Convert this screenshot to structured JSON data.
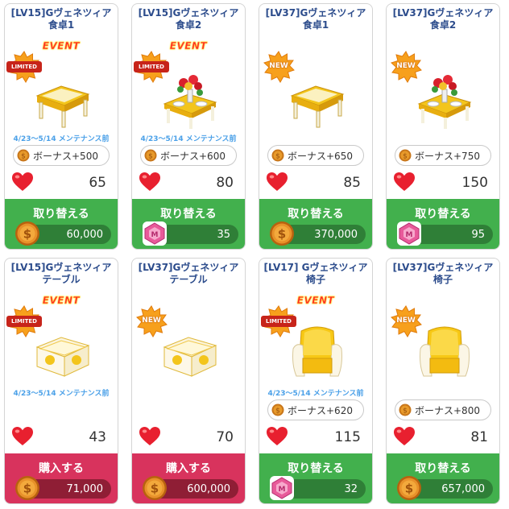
{
  "event_text": "EVENT",
  "cards": [
    {
      "title": "[LV15]Gヴェネツィア",
      "subtitle": "食卓1",
      "badge": "LIMITED",
      "event": true,
      "item": "table-glass",
      "period": "4/23～5/14 メンテナンス前",
      "bonus": "ボーナス+500",
      "likes": "65",
      "action": "取り替える",
      "action_color": "green",
      "currency": "coin",
      "price": "60,000"
    },
    {
      "title": "[LV15]Gヴェネツィア",
      "subtitle": "食卓2",
      "badge": "LIMITED",
      "event": true,
      "item": "table-flowers",
      "period": "4/23～5/14 メンテナンス前",
      "bonus": "ボーナス+600",
      "likes": "80",
      "action": "取り替える",
      "action_color": "green",
      "currency": "gem",
      "price": "35"
    },
    {
      "title": "[LV37]Gヴェネツィア",
      "subtitle": "食卓1",
      "badge": "NEW",
      "event": false,
      "item": "table-glass",
      "period": "",
      "bonus": "ボーナス+650",
      "likes": "85",
      "action": "取り替える",
      "action_color": "green",
      "currency": "coin",
      "price": "370,000"
    },
    {
      "title": "[LV37]Gヴェネツィア",
      "subtitle": "食卓2",
      "badge": "NEW",
      "event": false,
      "item": "table-flowers",
      "period": "",
      "bonus": "ボーナス+750",
      "likes": "150",
      "action": "取り替える",
      "action_color": "green",
      "currency": "gem",
      "price": "95"
    },
    {
      "title": "[LV15]Gヴェネツィア",
      "subtitle": "テーブル",
      "badge": "LIMITED",
      "event": true,
      "item": "low-table",
      "period": "4/23～5/14 メンテナンス前",
      "bonus": "",
      "likes": "43",
      "action": "購入する",
      "action_color": "pink",
      "currency": "coin",
      "price": "71,000"
    },
    {
      "title": "[LV37]Gヴェネツィア",
      "subtitle": "テーブル",
      "badge": "NEW",
      "event": false,
      "item": "low-table",
      "period": "",
      "bonus": "",
      "likes": "70",
      "action": "購入する",
      "action_color": "pink",
      "currency": "coin",
      "price": "600,000"
    },
    {
      "title": "[LV17] Gヴェネツィア",
      "subtitle": "椅子",
      "badge": "LIMITED",
      "event": true,
      "item": "chair",
      "period": "4/23～5/14 メンテナンス前",
      "bonus": "ボーナス+620",
      "likes": "115",
      "action": "取り替える",
      "action_color": "green",
      "currency": "gem",
      "price": "32"
    },
    {
      "title": "[LV37]Gヴェネツィア",
      "subtitle": "椅子",
      "badge": "NEW",
      "event": false,
      "item": "chair",
      "period": "",
      "bonus": "ボーナス+800",
      "likes": "81",
      "action": "取り替える",
      "action_color": "green",
      "currency": "coin",
      "price": "657,000"
    }
  ]
}
